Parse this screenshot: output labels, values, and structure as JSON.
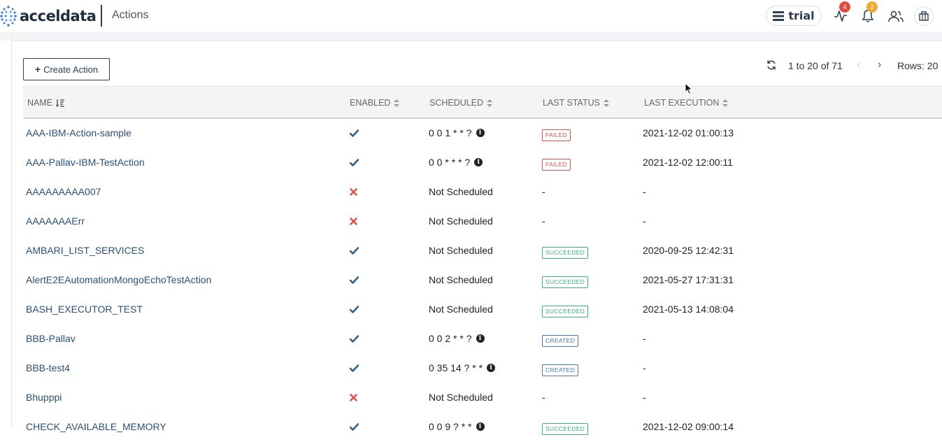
{
  "app": {
    "logo_text": "acceldata",
    "page_title": "Actions",
    "plan_label": "trial",
    "pulse_badge": "4",
    "bell_badge": "2"
  },
  "toolbar": {
    "create_label": "Create Action",
    "pagination_text": "1 to 20 of 71",
    "rows_label": "Rows: 20"
  },
  "table": {
    "columns": [
      "NAME",
      "ENABLED",
      "SCHEDULED",
      "LAST STATUS",
      "LAST EXECUTION"
    ],
    "rows": [
      {
        "name": "AAA-IBM-Action-sample",
        "enabled": true,
        "schedule": "0 0 1 * * ?",
        "info": true,
        "status": "FAILED",
        "last_exec": "2021-12-02 01:00:13"
      },
      {
        "name": "AAA-Pallav-IBM-TestAction",
        "enabled": true,
        "schedule": "0 0 * * * ?",
        "info": true,
        "status": "FAILED",
        "last_exec": "2021-12-02 12:00:11"
      },
      {
        "name": "AAAAAAAAA007",
        "enabled": false,
        "schedule": "Not Scheduled",
        "info": false,
        "status": "-",
        "last_exec": "-"
      },
      {
        "name": "AAAAAAAErr",
        "enabled": false,
        "schedule": "Not Scheduled",
        "info": false,
        "status": "-",
        "last_exec": "-"
      },
      {
        "name": "AMBARI_LIST_SERVICES",
        "enabled": true,
        "schedule": "Not Scheduled",
        "info": false,
        "status": "SUCCEEDED",
        "last_exec": "2020-09-25 12:42:31"
      },
      {
        "name": "AlertE2EAutomationMongoEchoTestAction",
        "enabled": true,
        "schedule": "Not Scheduled",
        "info": false,
        "status": "SUCCEEDED",
        "last_exec": "2021-05-27 17:31:31"
      },
      {
        "name": "BASH_EXECUTOR_TEST",
        "enabled": true,
        "schedule": "Not Scheduled",
        "info": false,
        "status": "SUCCEEDED",
        "last_exec": "2021-05-13 14:08:04"
      },
      {
        "name": "BBB-Pallav",
        "enabled": true,
        "schedule": "0 0 2 * * ?",
        "info": true,
        "status": "CREATED",
        "last_exec": "-"
      },
      {
        "name": "BBB-test4",
        "enabled": true,
        "schedule": "0 35 14 ? * *",
        "info": true,
        "status": "CREATED",
        "last_exec": "-"
      },
      {
        "name": "Bhupppi",
        "enabled": false,
        "schedule": "Not Scheduled",
        "info": false,
        "status": "-",
        "last_exec": "-"
      },
      {
        "name": "CHECK_AVAILABLE_MEMORY",
        "enabled": true,
        "schedule": "0 0 9 ? * *",
        "info": true,
        "status": "SUCCEEDED",
        "last_exec": "2021-12-02 09:00:14"
      }
    ]
  },
  "colors": {
    "link": "#2a5078",
    "check": "#2c5f8a",
    "cross": "#d9534f",
    "failed": "#d9534f",
    "succeeded": "#3bb27a",
    "created": "#4a74b4",
    "pulse_badge": "#e04a3f",
    "bell_badge": "#f0a830"
  },
  "icons": {
    "logo": "dots-logo-icon",
    "plan": "server-stack-icon",
    "pulse": "activity-icon",
    "bell": "bell-icon",
    "users": "users-icon",
    "building": "building-icon",
    "refresh": "refresh-icon",
    "prev": "chevron-left-icon",
    "next": "chevron-right-icon",
    "sort_name": "sort-descending-icon",
    "sort": "sort-icon",
    "enabled_true": "check-icon",
    "enabled_false": "cross-icon",
    "info": "info-icon"
  }
}
